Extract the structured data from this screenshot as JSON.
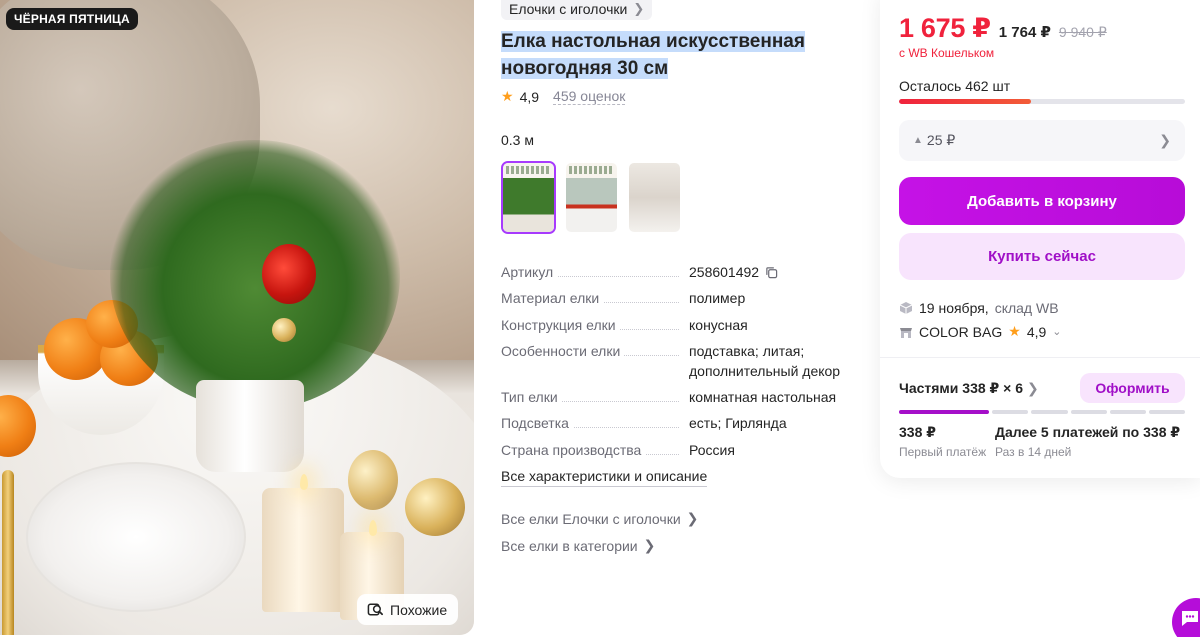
{
  "badge": "ЧЁРНАЯ ПЯТНИЦА",
  "similar_label": "Похожие",
  "breadcrumb": "Елочки с иголочки",
  "title": "Елка настольная искусственная новогодняя 30 см",
  "rating": {
    "value": "4,9",
    "reviews": "459 оценок"
  },
  "size_label": "0.3 м",
  "thumbnails": [
    "Вариант 1",
    "Вариант 2",
    "Вариант 3"
  ],
  "specs": [
    {
      "k": "Артикул",
      "v": "258601492"
    },
    {
      "k": "Материал елки",
      "v": "полимер"
    },
    {
      "k": "Конструкция елки",
      "v": "конусная"
    },
    {
      "k": "Особенности елки",
      "v": "подставка; литая; дополнительный декор"
    },
    {
      "k": "Тип елки",
      "v": "комнатная настольная"
    },
    {
      "k": "Подсветка",
      "v": "есть; Гирлянда"
    },
    {
      "k": "Страна производства",
      "v": "Россия"
    }
  ],
  "all_chars": "Все характеристики и описание",
  "more_links": [
    "Все елки Елочки с иголочки",
    "Все елки в категории"
  ],
  "card": {
    "price_main": "1 675 ₽",
    "price_second": "1 764 ₽",
    "price_old": "9 940 ₽",
    "wallet_note": "с WB Кошельком",
    "stock_text": "Осталось 462 шт",
    "stock_level": 0.46,
    "points": "25 ₽",
    "add_to_cart": "Добавить в корзину",
    "buy_now": "Купить сейчас",
    "delivery_date": "19 ноября,",
    "delivery_wh": "склад WB",
    "seller_name": "COLOR BAG",
    "seller_rating": "4,9",
    "installments_title": "Частями 338 ₽ × 6",
    "arrange": "Оформить",
    "first_payment": "338 ₽",
    "first_payment_sub": "Первый платёж",
    "rest_payments": "Далее 5 платежей по 338 ₽",
    "rest_payments_sub": "Раз в 14 дней",
    "segments_total": 6,
    "segments_active": 1
  },
  "colors": {
    "accent": "#cb11ab",
    "price": "#f0223c",
    "star": "#ff9e1b",
    "highlight": "#c5dcfb"
  }
}
